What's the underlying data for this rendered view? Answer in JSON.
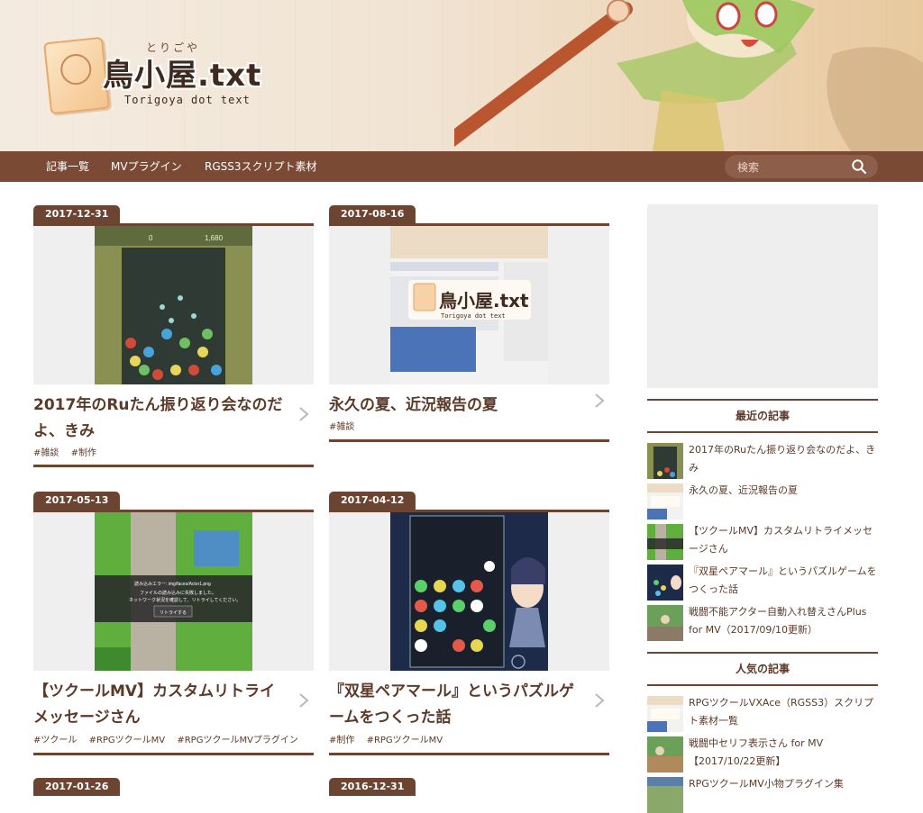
{
  "header": {
    "logo_kana": "とりごや",
    "logo_main": "鳥小屋.txt",
    "logo_sub": "Torigoya dot text"
  },
  "nav": {
    "items": [
      "記事一覧",
      "MVプラグイン",
      "RGSS3スクリプト素材"
    ],
    "search_placeholder": "検索"
  },
  "posts": [
    {
      "date": "2017-12-31",
      "title": "2017年のRuたん振り返り会なのだよ、きみ",
      "tags": [
        "#雑談",
        "#制作"
      ]
    },
    {
      "date": "2017-08-16",
      "title": "永久の夏、近況報告の夏",
      "tags": [
        "#雑談"
      ]
    },
    {
      "date": "2017-05-13",
      "title": "【ツクールMV】カスタムリトライメッセージさん",
      "tags": [
        "#ツクール",
        "#RPGツクールMV",
        "#RPGツクールMVプラグイン"
      ]
    },
    {
      "date": "2017-04-12",
      "title": "『双星ペアマール』というパズルゲームをつくった話",
      "tags": [
        "#制作",
        "#RPGツクールMV"
      ]
    },
    {
      "date": "2017-01-26",
      "title": "",
      "tags": []
    },
    {
      "date": "2016-12-31",
      "title": "",
      "tags": []
    }
  ],
  "thumb_texts": {
    "score_left": "0",
    "score_right": "1,680",
    "logo_overlay_main": "鳥小屋.txt",
    "logo_overlay_sub": "Torigoya dot text",
    "error_title": "読み込みエラー: img/faces/Actor1.png",
    "error_body1": "ファイルの読み込みに失敗しました。",
    "error_body2": "ネットワーク状況を確認して、リトライしてください。",
    "retry_button": "リトライする"
  },
  "sidebar": {
    "recent_heading": "最近の記事",
    "recent": [
      "2017年のRuたん振り返り会なのだよ、きみ",
      "永久の夏、近況報告の夏",
      "【ツクールMV】カスタムリトライメッセージさん",
      "『双星ペアマール』というパズルゲームをつくった話",
      "戦闘不能アクター自動入れ替えさんPlus for MV（2017/09/10更新）"
    ],
    "popular_heading": "人気の記事",
    "popular": [
      "RPGツクールVXAce（RGSS3）スクリプト素材一覧",
      "戦闘中セリフ表示さん for MV【2017/10/22更新】",
      "RPGツクールMV小物プラグイン集"
    ]
  },
  "colors": {
    "brand_brown": "#6b4432",
    "nav_brown": "#7a4a35",
    "text_brown": "#5b3a29"
  },
  "icons": [
    "search-icon",
    "chevron-right-icon"
  ]
}
